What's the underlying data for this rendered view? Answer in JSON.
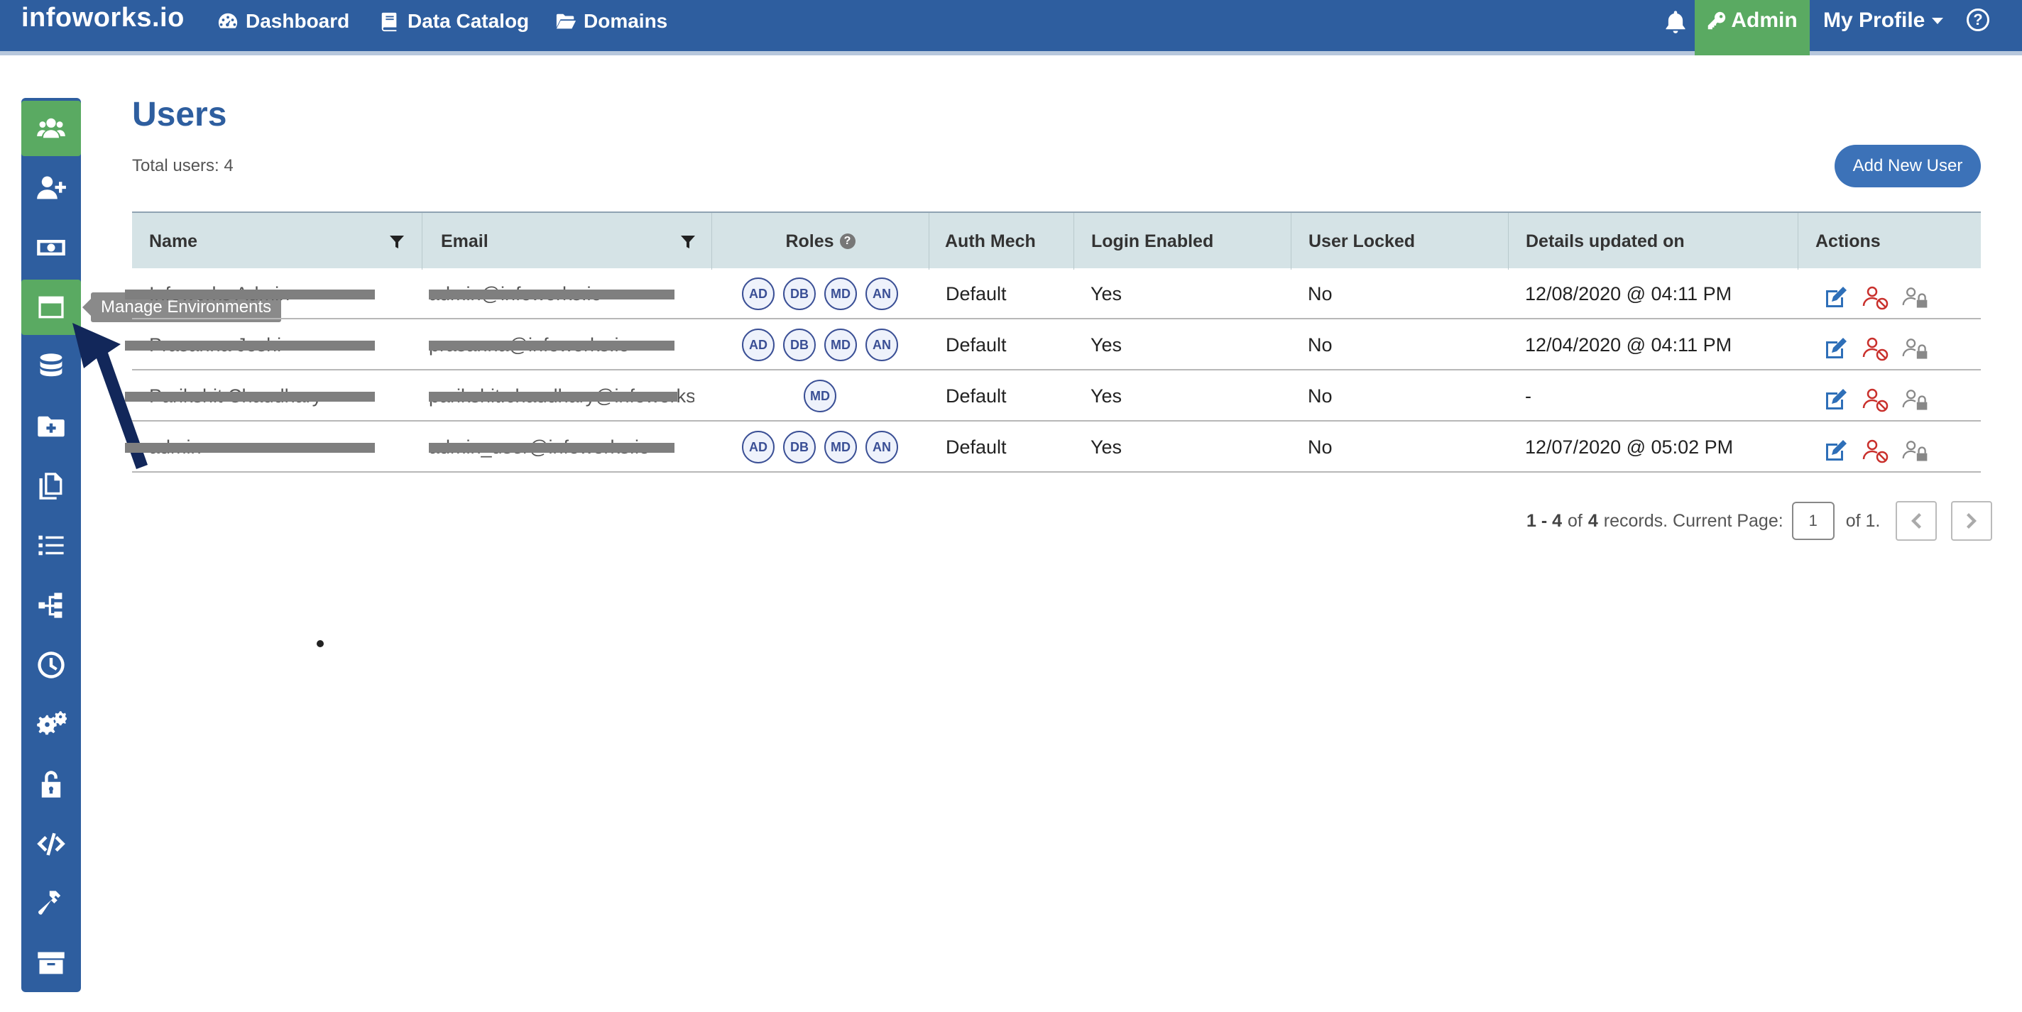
{
  "brand": "infoworks.io",
  "nav": [
    {
      "label": "Dashboard",
      "icon": "dashboard-icon"
    },
    {
      "label": "Data Catalog",
      "icon": "book-icon"
    },
    {
      "label": "Domains",
      "icon": "folder-open-icon"
    }
  ],
  "admin_label": "Admin",
  "profile_label": "My Profile",
  "help_glyph": "?",
  "sidebar": {
    "items": [
      {
        "icon": "users-icon",
        "active": true
      },
      {
        "icon": "add-user-icon"
      },
      {
        "icon": "money-icon"
      },
      {
        "icon": "environment-window-icon",
        "active": true
      },
      {
        "icon": "database-icon"
      },
      {
        "icon": "folder-plus-icon"
      },
      {
        "icon": "copy-icon"
      },
      {
        "icon": "list-icon"
      },
      {
        "icon": "sitemap-icon"
      },
      {
        "icon": "clock-icon"
      },
      {
        "icon": "gears-icon"
      },
      {
        "icon": "unlock-icon"
      },
      {
        "icon": "code-icon"
      },
      {
        "icon": "hammer-icon"
      },
      {
        "icon": "archive-icon"
      }
    ],
    "tooltip": "Manage Environments"
  },
  "page": {
    "title": "Users",
    "total": "Total users: 4",
    "add_button": "Add New User"
  },
  "table": {
    "headers": {
      "name": "Name",
      "email": "Email",
      "roles": "Roles",
      "auth": "Auth Mech",
      "login": "Login Enabled",
      "locked": "User Locked",
      "updated": "Details updated on",
      "actions": "Actions"
    },
    "rows": [
      {
        "name": "Infoworks Admin",
        "email": "admin@infoworks.io",
        "roles": [
          "AD",
          "DB",
          "MD",
          "AN"
        ],
        "auth": "Default",
        "login": "Yes",
        "locked": "No",
        "updated": "12/08/2020 @ 04:11 PM"
      },
      {
        "name": "Prasanna Joshi",
        "email": "prasanna@infoworks.io",
        "roles": [
          "AD",
          "DB",
          "MD",
          "AN"
        ],
        "auth": "Default",
        "login": "Yes",
        "locked": "No",
        "updated": "12/04/2020 @ 04:11 PM"
      },
      {
        "name": "Parikshit Chaudhary",
        "email": "parikshit.chaudhary@infoworks…",
        "roles": [
          "MD"
        ],
        "auth": "Default",
        "login": "Yes",
        "locked": "No",
        "updated": "-"
      },
      {
        "name": "admin",
        "email": "admin_user@infoworks.io",
        "roles": [
          "AD",
          "DB",
          "MD",
          "AN"
        ],
        "auth": "Default",
        "login": "Yes",
        "locked": "No",
        "updated": "12/07/2020 @ 05:02 PM"
      }
    ]
  },
  "pager": {
    "range": "1 - 4",
    "of_label": "of",
    "total": "4",
    "records_label": "records. Current Page:",
    "current_page": "1",
    "of_pages": "of 1."
  },
  "colors": {
    "nav_bg": "#2e5e9f",
    "active_green": "#5aaa62",
    "header_row": "#d5e3e6",
    "button_blue": "#3c72b8"
  }
}
